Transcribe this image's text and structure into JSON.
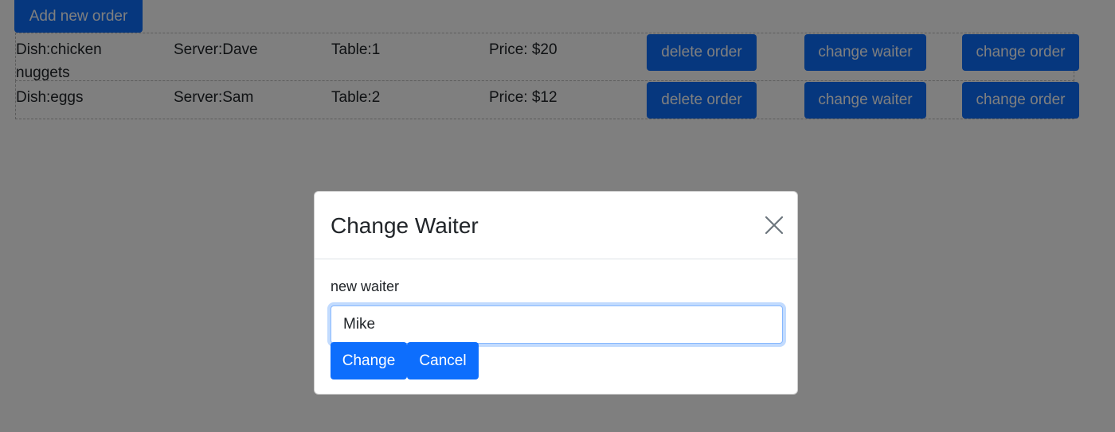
{
  "toolbar": {
    "add_label": "Add new order"
  },
  "orders": [
    {
      "dish": "Dish:chicken nuggets",
      "server": "Server:Dave",
      "table": "Table:1",
      "price": "Price: $20"
    },
    {
      "dish": "Dish:eggs",
      "server": "Server:Sam",
      "table": "Table:2",
      "price": "Price: $12"
    }
  ],
  "row_actions": {
    "delete_label": "delete order",
    "change_waiter_label": "change waiter",
    "change_order_label": "change order"
  },
  "modal": {
    "title": "Change Waiter",
    "field_label": "new waiter",
    "input_value": "Mike",
    "change_label": "Change",
    "cancel_label": "Cancel"
  },
  "colors": {
    "primary": "#0d6efd",
    "backdrop": "rgba(0,0,0,0.5)",
    "row_border": "#b9b9b9"
  },
  "icons": {
    "close": "close-icon"
  }
}
